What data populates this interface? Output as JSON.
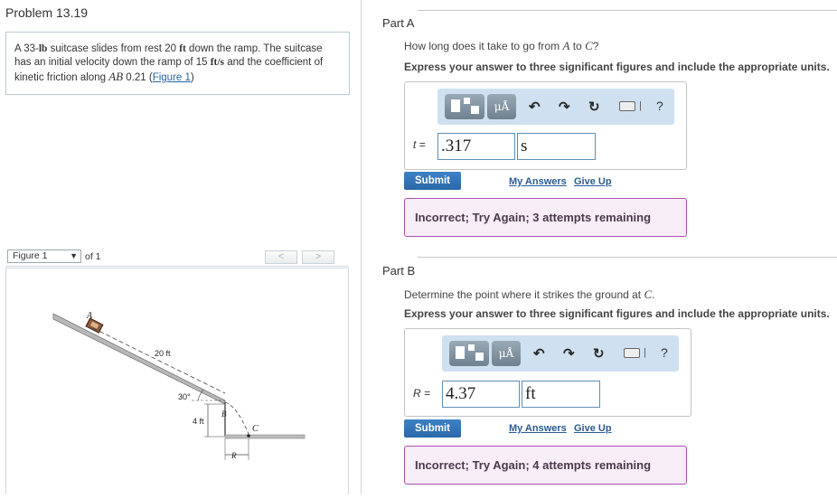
{
  "problem": {
    "title": "Problem 13.19",
    "text_1": "A 33-",
    "unit_lb": "lb",
    "text_2": " suitcase slides from rest 20 ",
    "unit_ft": "ft",
    "text_3": " down the ramp. The suitcase has an initial velocity down the ramp of 15 ",
    "unit_fts": "ft/s",
    "text_4": " and the coefficient of kinetic friction along ",
    "ab": "AB",
    "text_5": " 0.21 (",
    "figure_link": "Figure 1",
    "text_6": ")"
  },
  "figure_bar": {
    "selected": "Figure 1",
    "of_text": "of 1",
    "prev": "<",
    "next": ">"
  },
  "figure": {
    "label_a": "A",
    "label_b": "B",
    "label_c": "C",
    "label_r": "R",
    "dim_20ft": "20 ft",
    "angle": "30°",
    "dim_4ft": "4 ft"
  },
  "partA": {
    "label": "Part A",
    "question_1": "How long does it take to go from ",
    "var_a": "A",
    "question_2": " to ",
    "var_c": "C",
    "question_3": "?",
    "instructions": "Express your answer to three significant figures and include the appropriate units.",
    "variable": "t =",
    "value": ".317",
    "unit": "s",
    "submit": "Submit",
    "my_answers": "My Answers",
    "give_up": "Give Up",
    "feedback": "Incorrect; Try Again; 3 attempts remaining"
  },
  "partB": {
    "label": "Part B",
    "question_1": "Determine the point where it strikes the ground at ",
    "var_c": "C",
    "question_2": ".",
    "instructions": "Express your answer to three significant figures and include the appropriate units.",
    "variable": "R =",
    "value": "4.37",
    "unit": "ft",
    "submit": "Submit",
    "my_answers": "My Answers",
    "give_up": "Give Up",
    "feedback": "Incorrect; Try Again; 4 attempts remaining"
  },
  "toolbar": {
    "units_button": "μÅ",
    "help": "?",
    "separator": "|"
  }
}
